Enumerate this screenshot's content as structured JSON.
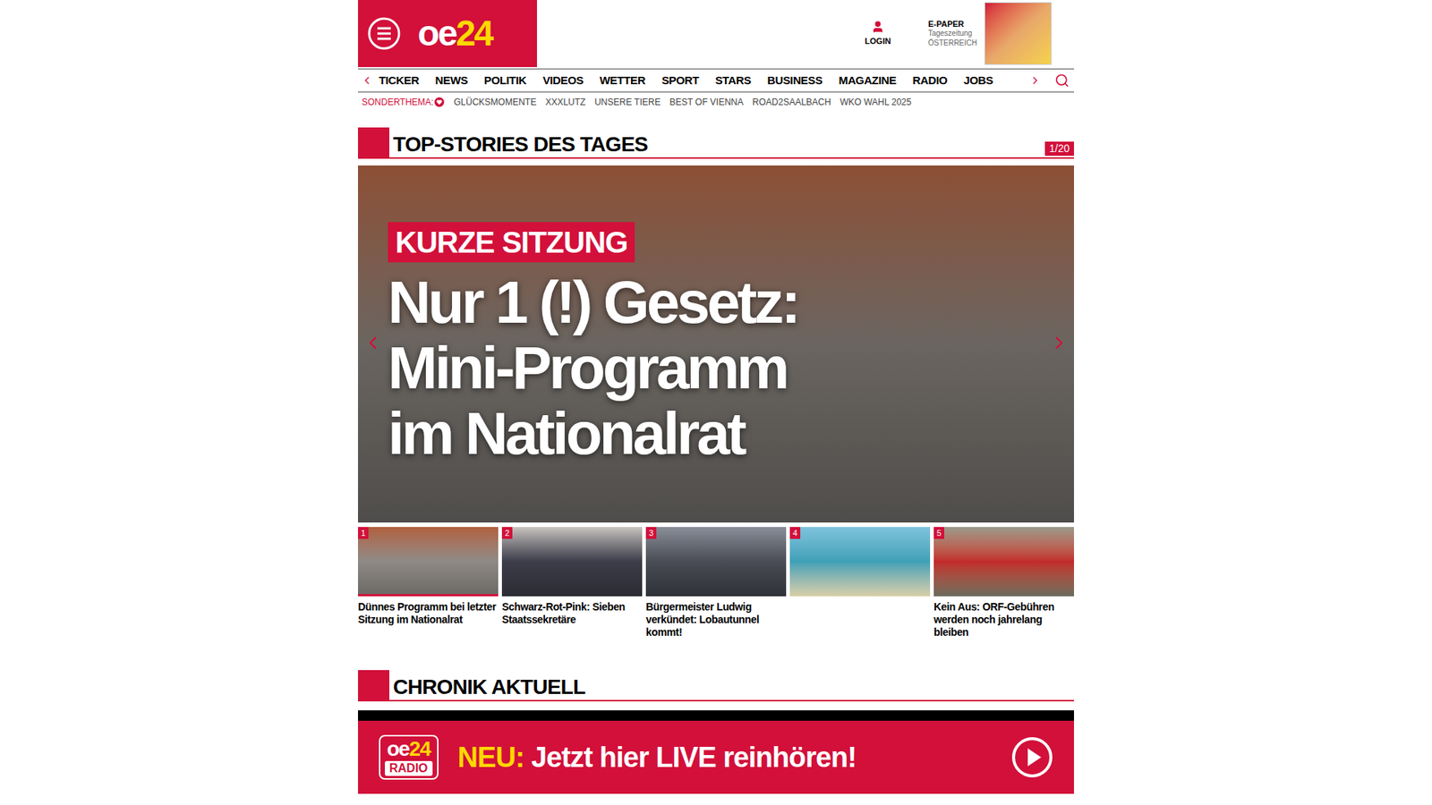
{
  "header": {
    "logo_main": "oe",
    "logo_accent": "24",
    "login": "LOGIN",
    "epaper": {
      "title": "E-PAPER",
      "subtitle": "Tageszeitung",
      "region": "ÖSTERREICH"
    }
  },
  "nav": {
    "items": [
      "TICKER",
      "NEWS",
      "POLITIK",
      "VIDEOS",
      "WETTER",
      "SPORT",
      "STARS",
      "BUSINESS",
      "MAGAZINE",
      "RADIO",
      "JOBS"
    ]
  },
  "subnav": {
    "label": "SONDERTHEMA:",
    "items": [
      "GLÜCKSMOMENTE",
      "XXXLUTZ",
      "UNSERE TIERE",
      "BEST OF VIENNA",
      "ROAD2SAALBACH",
      "WKO WAHL 2025"
    ]
  },
  "top_stories": {
    "title": "TOP-STORIES DES TAGES",
    "counter": "1/20",
    "hero": {
      "tag": "KURZE SITZUNG",
      "headline": [
        "Nur 1 (!) Gesetz:",
        "Mini-Programm",
        "im Nationalrat"
      ]
    },
    "items": [
      {
        "number": "1",
        "caption": "Dünnes Programm bei letzter Sitzung im Nationalrat",
        "selected": true
      },
      {
        "number": "2",
        "caption": "Schwarz-Rot-Pink: Sieben Staatssekretäre",
        "selected": false
      },
      {
        "number": "3",
        "caption": "Bürgermeister Ludwig verkündet: Lobautunnel kommt!",
        "selected": false
      },
      {
        "number": "4",
        "selected": false
      },
      {
        "number": "5",
        "caption": "Kein Aus: ORF-Gebühren werden noch jahrelang bleiben",
        "selected": false
      }
    ]
  },
  "chronik": {
    "title": "CHRONIK AKTUELL"
  },
  "radio_banner": {
    "logo_main": "oe",
    "logo_accent": "24",
    "logo_sub": "RADIO",
    "highlight": "NEU:",
    "text": "Jetzt hier LIVE reinhören!"
  }
}
